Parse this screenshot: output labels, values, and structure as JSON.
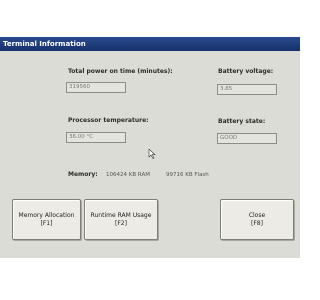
{
  "window": {
    "title": "Terminal Information"
  },
  "power_on": {
    "label": "Total power on time (minutes):",
    "value": "319560"
  },
  "battery_voltage": {
    "label": "Battery voltage:",
    "value": "3.85"
  },
  "processor_temp": {
    "label": "Processor temperature:",
    "value": "36.00 °C"
  },
  "battery_state": {
    "label": "Battery state:",
    "value": "GOOD"
  },
  "memory": {
    "label": "Memory:",
    "ram": "106424 KB RAM",
    "flash": "99716 KB Flash"
  },
  "buttons": {
    "memory_allocation": {
      "line1": "Memory Allocation",
      "line2": "[F1]"
    },
    "runtime_ram": {
      "line1": "Runtime RAM Usage",
      "line2": "[F2]"
    },
    "close": {
      "line1": "Close",
      "line2": "[F8]"
    }
  }
}
